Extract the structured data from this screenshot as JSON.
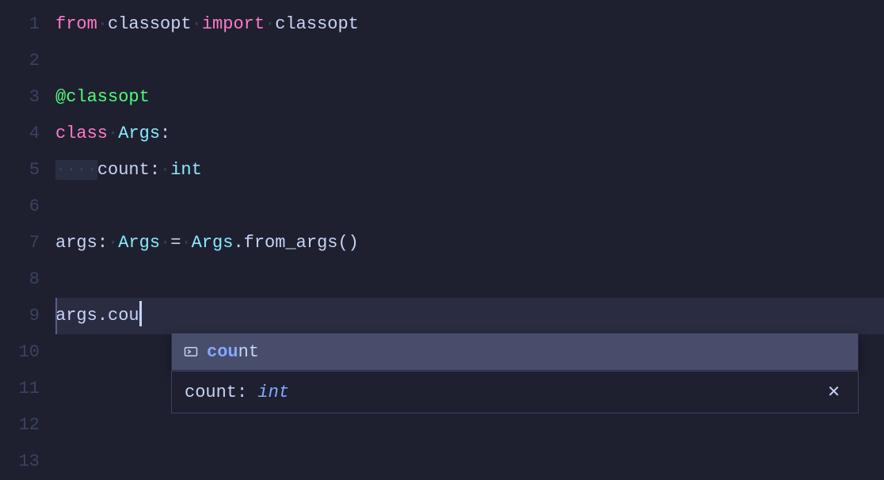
{
  "gutter": {
    "lines": [
      "1",
      "2",
      "3",
      "4",
      "5",
      "6",
      "7",
      "8",
      "9",
      "10",
      "11",
      "12",
      "13"
    ]
  },
  "code": {
    "line1": {
      "from": "from",
      "ws1": "·",
      "mod": "classopt",
      "ws2": "·",
      "import": "import",
      "ws3": "·",
      "name": "classopt"
    },
    "line3": {
      "decorator": "@classopt"
    },
    "line4": {
      "class": "class",
      "ws": "·",
      "name": "Args",
      "colon": ":"
    },
    "line5": {
      "indent": "····",
      "attr": "count",
      "colon": ":",
      "ws": "·",
      "type": "int"
    },
    "line7": {
      "var": "args",
      "colon": ":",
      "ws1": "·",
      "type": "Args",
      "ws2": "·",
      "eq": "=",
      "ws3": "·",
      "cls": "Args",
      "dot": ".",
      "method": "from_args",
      "parens": "()"
    },
    "line9": {
      "var": "args",
      "dot": ".",
      "partial": "cou"
    }
  },
  "autocomplete": {
    "match": "cou",
    "rest": "nt"
  },
  "detail": {
    "name": "count",
    "sep": ": ",
    "type": "int"
  },
  "close": "✕"
}
